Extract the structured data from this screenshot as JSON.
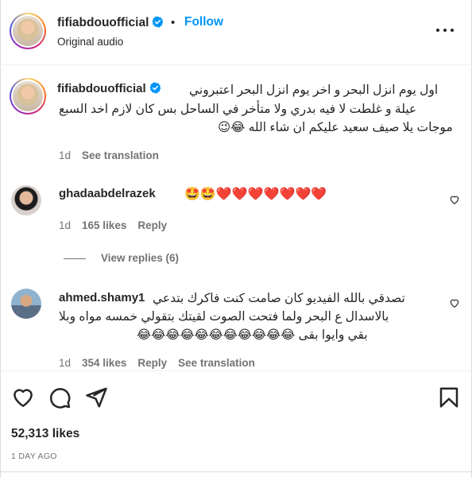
{
  "header": {
    "username": "fifiabdouofficial",
    "dot": "•",
    "follow_label": "Follow",
    "subtitle": "Original audio"
  },
  "caption": {
    "username": "fifiabdouofficial",
    "lines": [
      "اول يوم انزل البحر و اخر يوم انزل البحر اعتبروني",
      "عيلة و غلطت لا فيه بدري ولا متأخر في الساحل بس كان لازم اخد السبع",
      "موجات يلا صيف سعيد عليكم ان شاء الله 😂😉"
    ],
    "time": "1d",
    "see_translation": "See translation"
  },
  "comments": [
    {
      "username": "ghadaabdelrazek",
      "text": "❤️❤️❤️❤️❤️❤️❤️🤩🤩",
      "time": "1d",
      "likes": "165 likes",
      "reply": "Reply",
      "view_replies": "View replies (6)"
    },
    {
      "username": "ahmed.shamy1",
      "lines": [
        "تصدقي بالله الفيديو كان صامت كنت فاكرك بتدعي",
        "بالاسدال ع البحر ولما فتحت الصوت لقيتك بتقولي خمسه مواه وبلا",
        "بقي وايوا بقى 😂😂😂😂😂😂😂😂😂😂😂"
      ],
      "time": "1d",
      "likes": "354 likes",
      "reply": "Reply",
      "see_translation": "See translation"
    }
  ],
  "footer": {
    "likes": "52,313 likes",
    "time_ago": "1 DAY AGO"
  },
  "colors": {
    "link_blue": "#0095f6",
    "verified_blue": "#0095f6",
    "muted": "#737373",
    "text": "#262626"
  },
  "icons": [
    "more-icon",
    "verified-icon",
    "heart-icon",
    "comment-icon",
    "share-icon",
    "save-icon"
  ]
}
